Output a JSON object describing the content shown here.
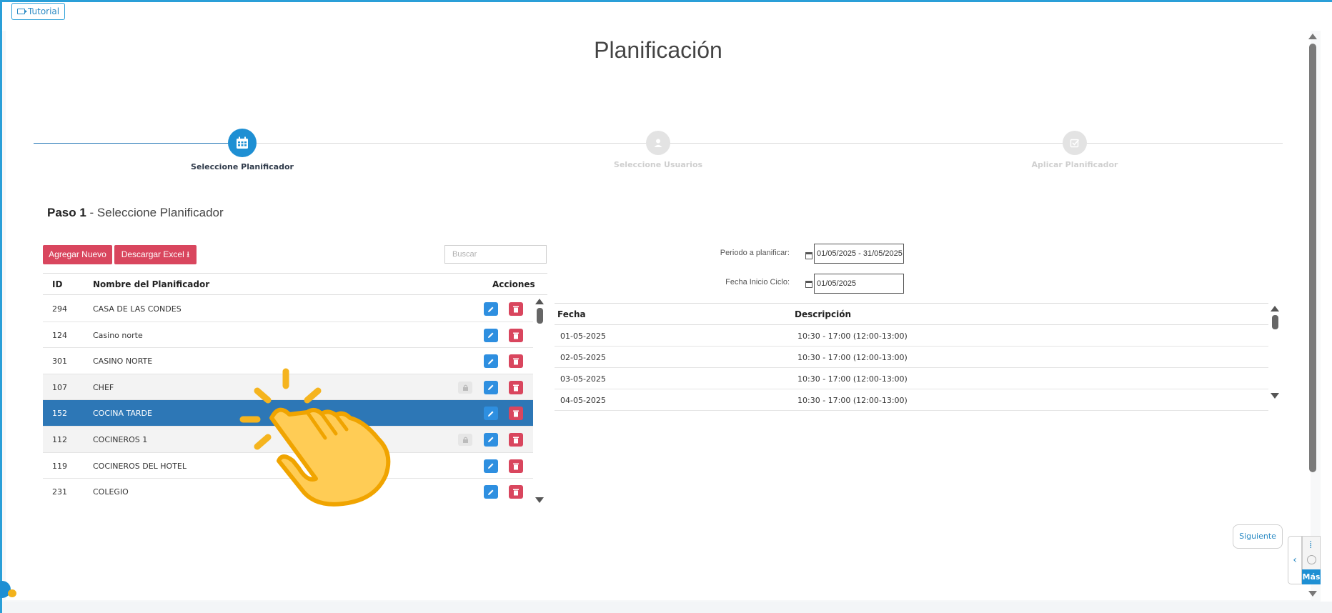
{
  "app": {
    "tutorial_label": "Tutorial",
    "page_title": "Planificación"
  },
  "stepper": [
    {
      "label": "Seleccione Planificador",
      "state": "active"
    },
    {
      "label": "Seleccione Usuarios",
      "state": "pending"
    },
    {
      "label": "Aplicar Planificador",
      "state": "pending"
    }
  ],
  "step_heading": {
    "bold": "Paso 1",
    "rest": " - Seleccione Planificador"
  },
  "toolbar": {
    "add_label": "Agregar Nuevo",
    "excel_label": "Descargar Excel",
    "search_placeholder": "Buscar"
  },
  "planners_table": {
    "headers": {
      "id": "ID",
      "name": "Nombre del Planificador",
      "actions": "Acciones"
    },
    "rows": [
      {
        "id": "294",
        "name": "CASA DE LAS CONDES",
        "locked": false,
        "selected": false
      },
      {
        "id": "124",
        "name": "Casino norte",
        "locked": false,
        "selected": false
      },
      {
        "id": "301",
        "name": "CASINO NORTE",
        "locked": false,
        "selected": false
      },
      {
        "id": "107",
        "name": "CHEF",
        "locked": true,
        "selected": false
      },
      {
        "id": "152",
        "name": "COCINA TARDE",
        "locked": false,
        "selected": true
      },
      {
        "id": "112",
        "name": "COCINEROS 1",
        "locked": true,
        "selected": false
      },
      {
        "id": "119",
        "name": "COCINEROS DEL HOTEL",
        "locked": false,
        "selected": false
      },
      {
        "id": "231",
        "name": "COLEGIO",
        "locked": false,
        "selected": false
      }
    ]
  },
  "period": {
    "period_label": "Periodo a planificar:",
    "period_value": "01/05/2025 - 31/05/2025",
    "cycle_label": "Fecha Inicio Ciclo:",
    "cycle_value": "01/05/2025"
  },
  "schedule_table": {
    "headers": {
      "date": "Fecha",
      "description": "Descripción"
    },
    "rows": [
      {
        "date": "01-05-2025",
        "description": "10:30 - 17:00 (12:00-13:00)"
      },
      {
        "date": "02-05-2025",
        "description": "10:30 - 17:00 (12:00-13:00)"
      },
      {
        "date": "03-05-2025",
        "description": "10:30 - 17:00 (12:00-13:00)"
      },
      {
        "date": "04-05-2025",
        "description": "10:30 - 17:00 (12:00-13:00)"
      }
    ]
  },
  "footer": {
    "next_label": "Siguiente",
    "more_label": "Más"
  },
  "colors": {
    "primary": "#1e8fd3",
    "danger": "#d9465e",
    "selected_row": "#2d77b6"
  }
}
